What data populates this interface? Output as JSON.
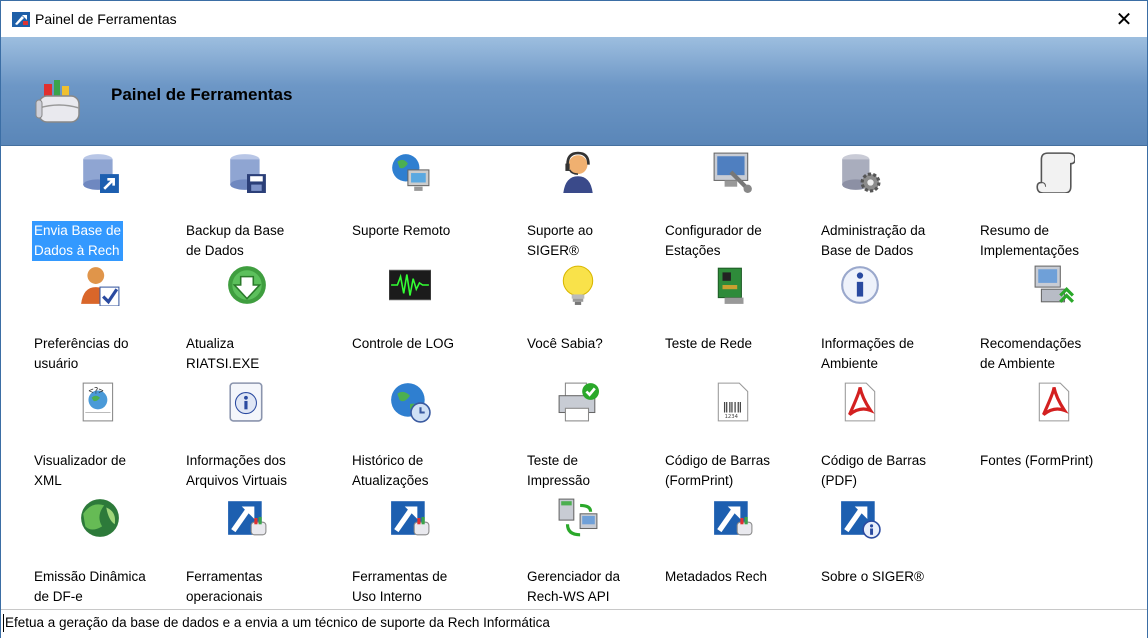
{
  "window": {
    "title": "Painel de Ferramentas",
    "close_glyph": "✕"
  },
  "banner": {
    "title": "Painel de Ferramentas",
    "icon": "toolbox-icon"
  },
  "tools": [
    {
      "label": "Envia Base de\nDados à Rech",
      "icon": "database-send-icon",
      "selected": true
    },
    {
      "label": "Backup da Base\nde Dados",
      "icon": "database-backup-icon"
    },
    {
      "label": "Suporte Remoto",
      "icon": "remote-support-globe-icon"
    },
    {
      "label": "Suporte ao\nSIGER®",
      "icon": "support-headset-icon"
    },
    {
      "label": "Configurador de\nEstações",
      "icon": "station-config-icon"
    },
    {
      "label": "Administração da\nBase de Dados",
      "icon": "database-admin-icon"
    },
    {
      "label": "Resumo de\nImplementações",
      "icon": "scroll-icon"
    },
    {
      "label": "Preferências do\nusuário",
      "icon": "user-preferences-icon"
    },
    {
      "label": "Atualiza\nRIATSI.EXE",
      "icon": "update-download-icon"
    },
    {
      "label": "Controle de LOG",
      "icon": "log-monitor-icon"
    },
    {
      "label": "Você Sabia?",
      "icon": "lightbulb-icon"
    },
    {
      "label": "Teste de Rede",
      "icon": "network-card-icon"
    },
    {
      "label": "Informações de\nAmbiente",
      "icon": "info-icon"
    },
    {
      "label": "Recomendações\nde Ambiente",
      "icon": "computer-upgrade-icon"
    },
    {
      "label": "Visualizador de\nXML",
      "icon": "xml-viewer-icon"
    },
    {
      "label": "Informações dos\nArquivos Virtuais",
      "icon": "info-document-icon"
    },
    {
      "label": "Histórico de\nAtualizações",
      "icon": "history-globe-icon"
    },
    {
      "label": "Teste de\nImpressão",
      "icon": "printer-check-icon"
    },
    {
      "label": "Código de Barras\n(FormPrint)",
      "icon": "barcode-document-icon"
    },
    {
      "label": "Código de Barras\n(PDF)",
      "icon": "pdf-icon"
    },
    {
      "label": "Fontes (FormPrint)",
      "icon": "pdf-fonts-icon"
    },
    {
      "label": "Emissão Dinâmica\nde DF-e",
      "icon": "dfe-globe-icon"
    },
    {
      "label": "Ferramentas\noperacionais",
      "icon": "rech-toolbox-icon"
    },
    {
      "label": "Ferramentas de\nUso Interno",
      "icon": "rech-toolbox-icon"
    },
    {
      "label": "Gerenciador da\nRech-WS API",
      "icon": "servers-sync-icon"
    },
    {
      "label": "Metadados Rech",
      "icon": "rech-toolbox-icon"
    },
    {
      "label": "Sobre o SIGER®",
      "icon": "rech-info-icon"
    }
  ],
  "status": {
    "text": "Efetua a geração da base de dados e a envia a um técnico de suporte da Rech Informática"
  },
  "colors": {
    "banner_top": "#9dbedf",
    "banner_bottom": "#5a86b8",
    "selection": "#3399ff"
  }
}
